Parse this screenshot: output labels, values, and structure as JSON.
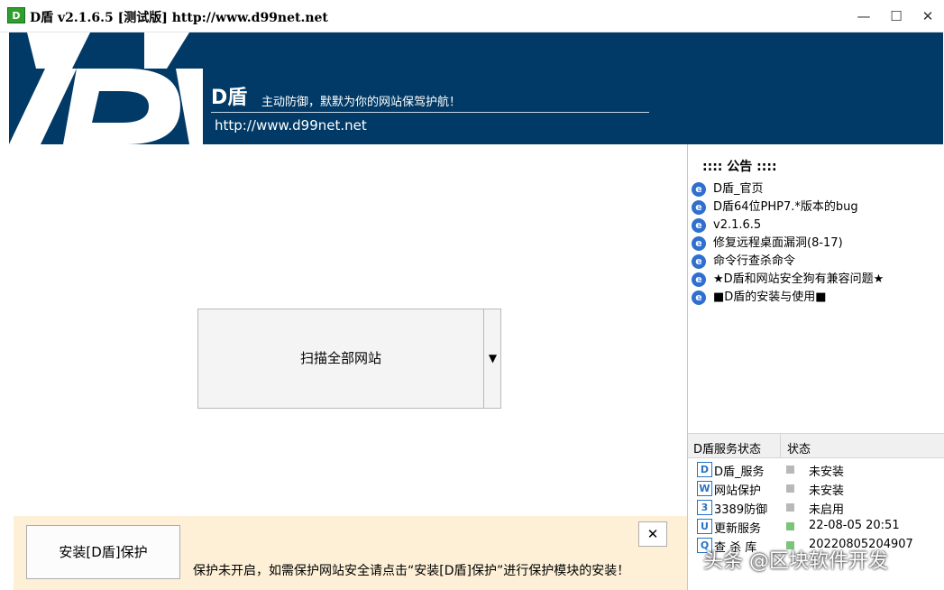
{
  "window": {
    "app_icon_text": "D",
    "title": "D盾 v2.1.6.5 [测试版] http://www.d99net.net",
    "min_glyph": "—",
    "max_glyph": "☐",
    "close_glyph": "✕"
  },
  "banner": {
    "brand": "D盾",
    "slogan": "主动防御，默默为你的网站保驾护航！",
    "url": "http://www.d99net.net"
  },
  "scan": {
    "label": "扫描全部网站",
    "arrow": "▼"
  },
  "notice_bar": {
    "install_label": "安装[D盾]保护",
    "message": "保护未开启，如需保护网站安全请点击“安装[D盾]保护”进行保护模块的安装！",
    "close_glyph": "✕"
  },
  "announcements": {
    "heading": ":::: 公告 ::::",
    "icon_glyph": "e",
    "items": [
      "D盾_官页",
      "D盾64位PHP7.*版本的bug",
      "v2.1.6.5",
      "修复远程桌面漏洞(8-17)",
      "命令行查杀命令",
      "★D盾和网站安全狗有兼容问题★",
      "■D盾的安装与使用■"
    ]
  },
  "services": {
    "col_name": "D盾服务状态",
    "col_status": "状态",
    "rows": [
      {
        "icon": "D",
        "name": "D盾_服务",
        "status": "未安装",
        "dot_color": "#b8b8b8"
      },
      {
        "icon": "W",
        "name": "网站保护",
        "status": "未安装",
        "dot_color": "#b8b8b8"
      },
      {
        "icon": "3",
        "name": "3389防御",
        "status": "未启用",
        "dot_color": "#b8b8b8"
      },
      {
        "icon": "U",
        "name": "更新服务",
        "status": "22-08-05 20:51",
        "dot_color": "#7cc47c"
      },
      {
        "icon": "Q",
        "name": "查 杀 库",
        "status": "20220805204907",
        "dot_color": "#7cc47c"
      }
    ]
  },
  "watermark": "头条 @区块软件开发"
}
